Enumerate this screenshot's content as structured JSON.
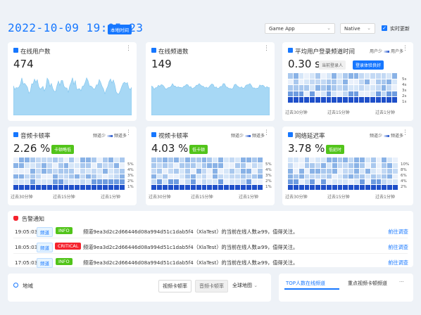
{
  "header": {
    "datetime": "2022-10-09 19:05:23",
    "timezone_badge": "本地时间",
    "app_select": "Game App",
    "platform_select": "Native",
    "realtime_label": "实时更新",
    "realtime_checked": true
  },
  "cards": {
    "online_users": {
      "title": "在线用户数",
      "value": "474",
      "icon": "user-icon"
    },
    "online_channels": {
      "title": "在线频道数",
      "value": "149",
      "icon": "channel-icon"
    },
    "avg_join_time": {
      "title": "平均用户登录频道时间",
      "value": "0.30 s",
      "badge_current": "当前登录人",
      "badge_status": "登录体验良好",
      "legend_low": "用户少",
      "legend_high": "用户多",
      "y_ticks": [
        "5s",
        "4s",
        "3s",
        "2s",
        "1s"
      ],
      "x_ticks": [
        "过去30分钟",
        "过去15分钟",
        "过去1分钟"
      ]
    },
    "audio_freeze": {
      "title": "音频卡顿率",
      "value": "2.26 %",
      "badge": "卡顿略低",
      "legend_low": "频道少",
      "legend_high": "频道多",
      "y_ticks": [
        "5%",
        "4%",
        "3%",
        "2%",
        "1%"
      ],
      "x_ticks": [
        "过去30分钟",
        "过去15分钟",
        "过去1分钟"
      ]
    },
    "video_freeze": {
      "title": "视频卡顿率",
      "value": "4.03 %",
      "badge": "低卡顿",
      "legend_low": "频道少",
      "legend_high": "频道多",
      "y_ticks": [
        "5%",
        "4%",
        "3%",
        "2%",
        "1%"
      ],
      "x_ticks": [
        "过去30分钟",
        "过去15分钟",
        "过去1分钟"
      ]
    },
    "network_delay": {
      "title": "网络延迟率",
      "value": "3.78 %",
      "badge": "低延时",
      "legend_low": "频道少",
      "legend_high": "频道多",
      "y_ticks": [
        "10%",
        "8%",
        "6%",
        "4%",
        "2%"
      ],
      "x_ticks": [
        "过去30分钟",
        "过去15分钟",
        "过去1分钟"
      ]
    }
  },
  "alerts": {
    "title": "告警通知",
    "rows": [
      {
        "time": "19:05:03",
        "type": "频道",
        "level": "INFO",
        "level_color": "#52c41a",
        "message": "频道9ea3d2c2d66446d08a994d51c1dab5f4（XlaTest）的当前在线人数≥99，值得关注。",
        "action": "前往调查"
      },
      {
        "time": "18:05:03",
        "type": "频道",
        "level": "CRITICAL",
        "level_color": "#f5222d",
        "message": "频道9ea3d2c2d66446d08a994d51c1dab5f4（XlaTest）的当前在线人数≥99，值得关注。",
        "action": "前往调查"
      },
      {
        "time": "17:05:03",
        "type": "频道",
        "level": "INFO",
        "level_color": "#52c41a",
        "message": "频道9ea3d2c2d66446d08a994d51c1dab5f4（XlaTest）的当前在线人数≥99，值得关注。",
        "action": "前往调查"
      }
    ]
  },
  "bottom": {
    "region_title": "地域",
    "tab_video": "视频卡顿率",
    "tab_audio": "音频卡顿率",
    "map_select": "全球地图",
    "right_tab_top": "TOP人数在线频道",
    "right_tab_focus": "重点视频卡顿频道",
    "more": "···"
  },
  "colors": {
    "accent": "#1677ff",
    "sparkline": "#a7d8f5",
    "heat_dark": "#1e4fc9",
    "heat_light": "#eaf1fb"
  }
}
